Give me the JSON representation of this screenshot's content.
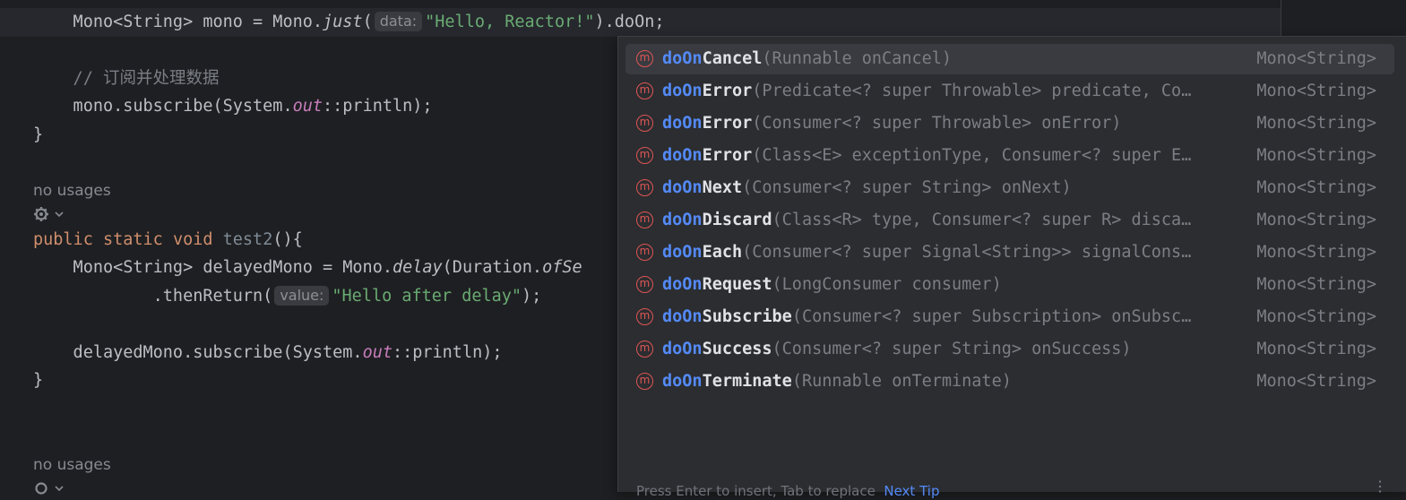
{
  "editor": {
    "line1": {
      "pre": "    Mono<String> mono = Mono.",
      "method": "just",
      "open": "(",
      "hint": "data:",
      "string": "\"Hello, Reactor!\"",
      "post": ").doOn;"
    },
    "comment": "    // 订阅并处理数据",
    "line_subscribe": {
      "pre": "    mono.subscribe(System.",
      "field": "out",
      "post": "::println);"
    },
    "brace1": "}",
    "usages1": "no usages",
    "line_decl": {
      "kw1": "public",
      "kw2": "static",
      "kw3": "void",
      "name": "test2",
      "post": "(){"
    },
    "line_delayed": {
      "pre": "    Mono<String> delayedMono = Mono.",
      "method": "delay",
      "mid": "(Duration.",
      "method2": "ofSe"
    },
    "line_then": {
      "pre": "            .thenReturn(",
      "hint": "value:",
      "string": "\"Hello after delay\"",
      "post": ");"
    },
    "line_delayed_sub": {
      "pre": "    delayedMono.subscribe(System.",
      "field": "out",
      "post": "::println);"
    },
    "brace2": "}",
    "usages2": "no usages"
  },
  "completion": {
    "prefix": "doOn",
    "items": [
      {
        "rest": "Cancel",
        "sig": "(Runnable onCancel)",
        "type": "Mono<String>"
      },
      {
        "rest": "Error",
        "sig": "(Predicate<? super Throwable> predicate, Co…",
        "type": "Mono<String>"
      },
      {
        "rest": "Error",
        "sig": "(Consumer<? super Throwable> onError)",
        "type": "Mono<String>"
      },
      {
        "rest": "Error",
        "sig": "(Class<E> exceptionType, Consumer<? super E…",
        "type": "Mono<String>"
      },
      {
        "rest": "Next",
        "sig": "(Consumer<? super String> onNext)",
        "type": "Mono<String>"
      },
      {
        "rest": "Discard",
        "sig": "(Class<R> type, Consumer<? super R> disca…",
        "type": "Mono<String>"
      },
      {
        "rest": "Each",
        "sig": "(Consumer<? super Signal<String>> signalCons…",
        "type": "Mono<String>"
      },
      {
        "rest": "Request",
        "sig": "(LongConsumer consumer)",
        "type": "Mono<String>"
      },
      {
        "rest": "Subscribe",
        "sig": "(Consumer<? super Subscription> onSubsc…",
        "type": "Mono<String>"
      },
      {
        "rest": "Success",
        "sig": "(Consumer<? super String> onSuccess)",
        "type": "Mono<String>"
      },
      {
        "rest": "Terminate",
        "sig": "(Runnable onTerminate)",
        "type": "Mono<String>"
      }
    ],
    "icon_letter": "m",
    "footer_text": "Press Enter to insert, Tab to replace  ",
    "footer_link": "Next Tip"
  }
}
